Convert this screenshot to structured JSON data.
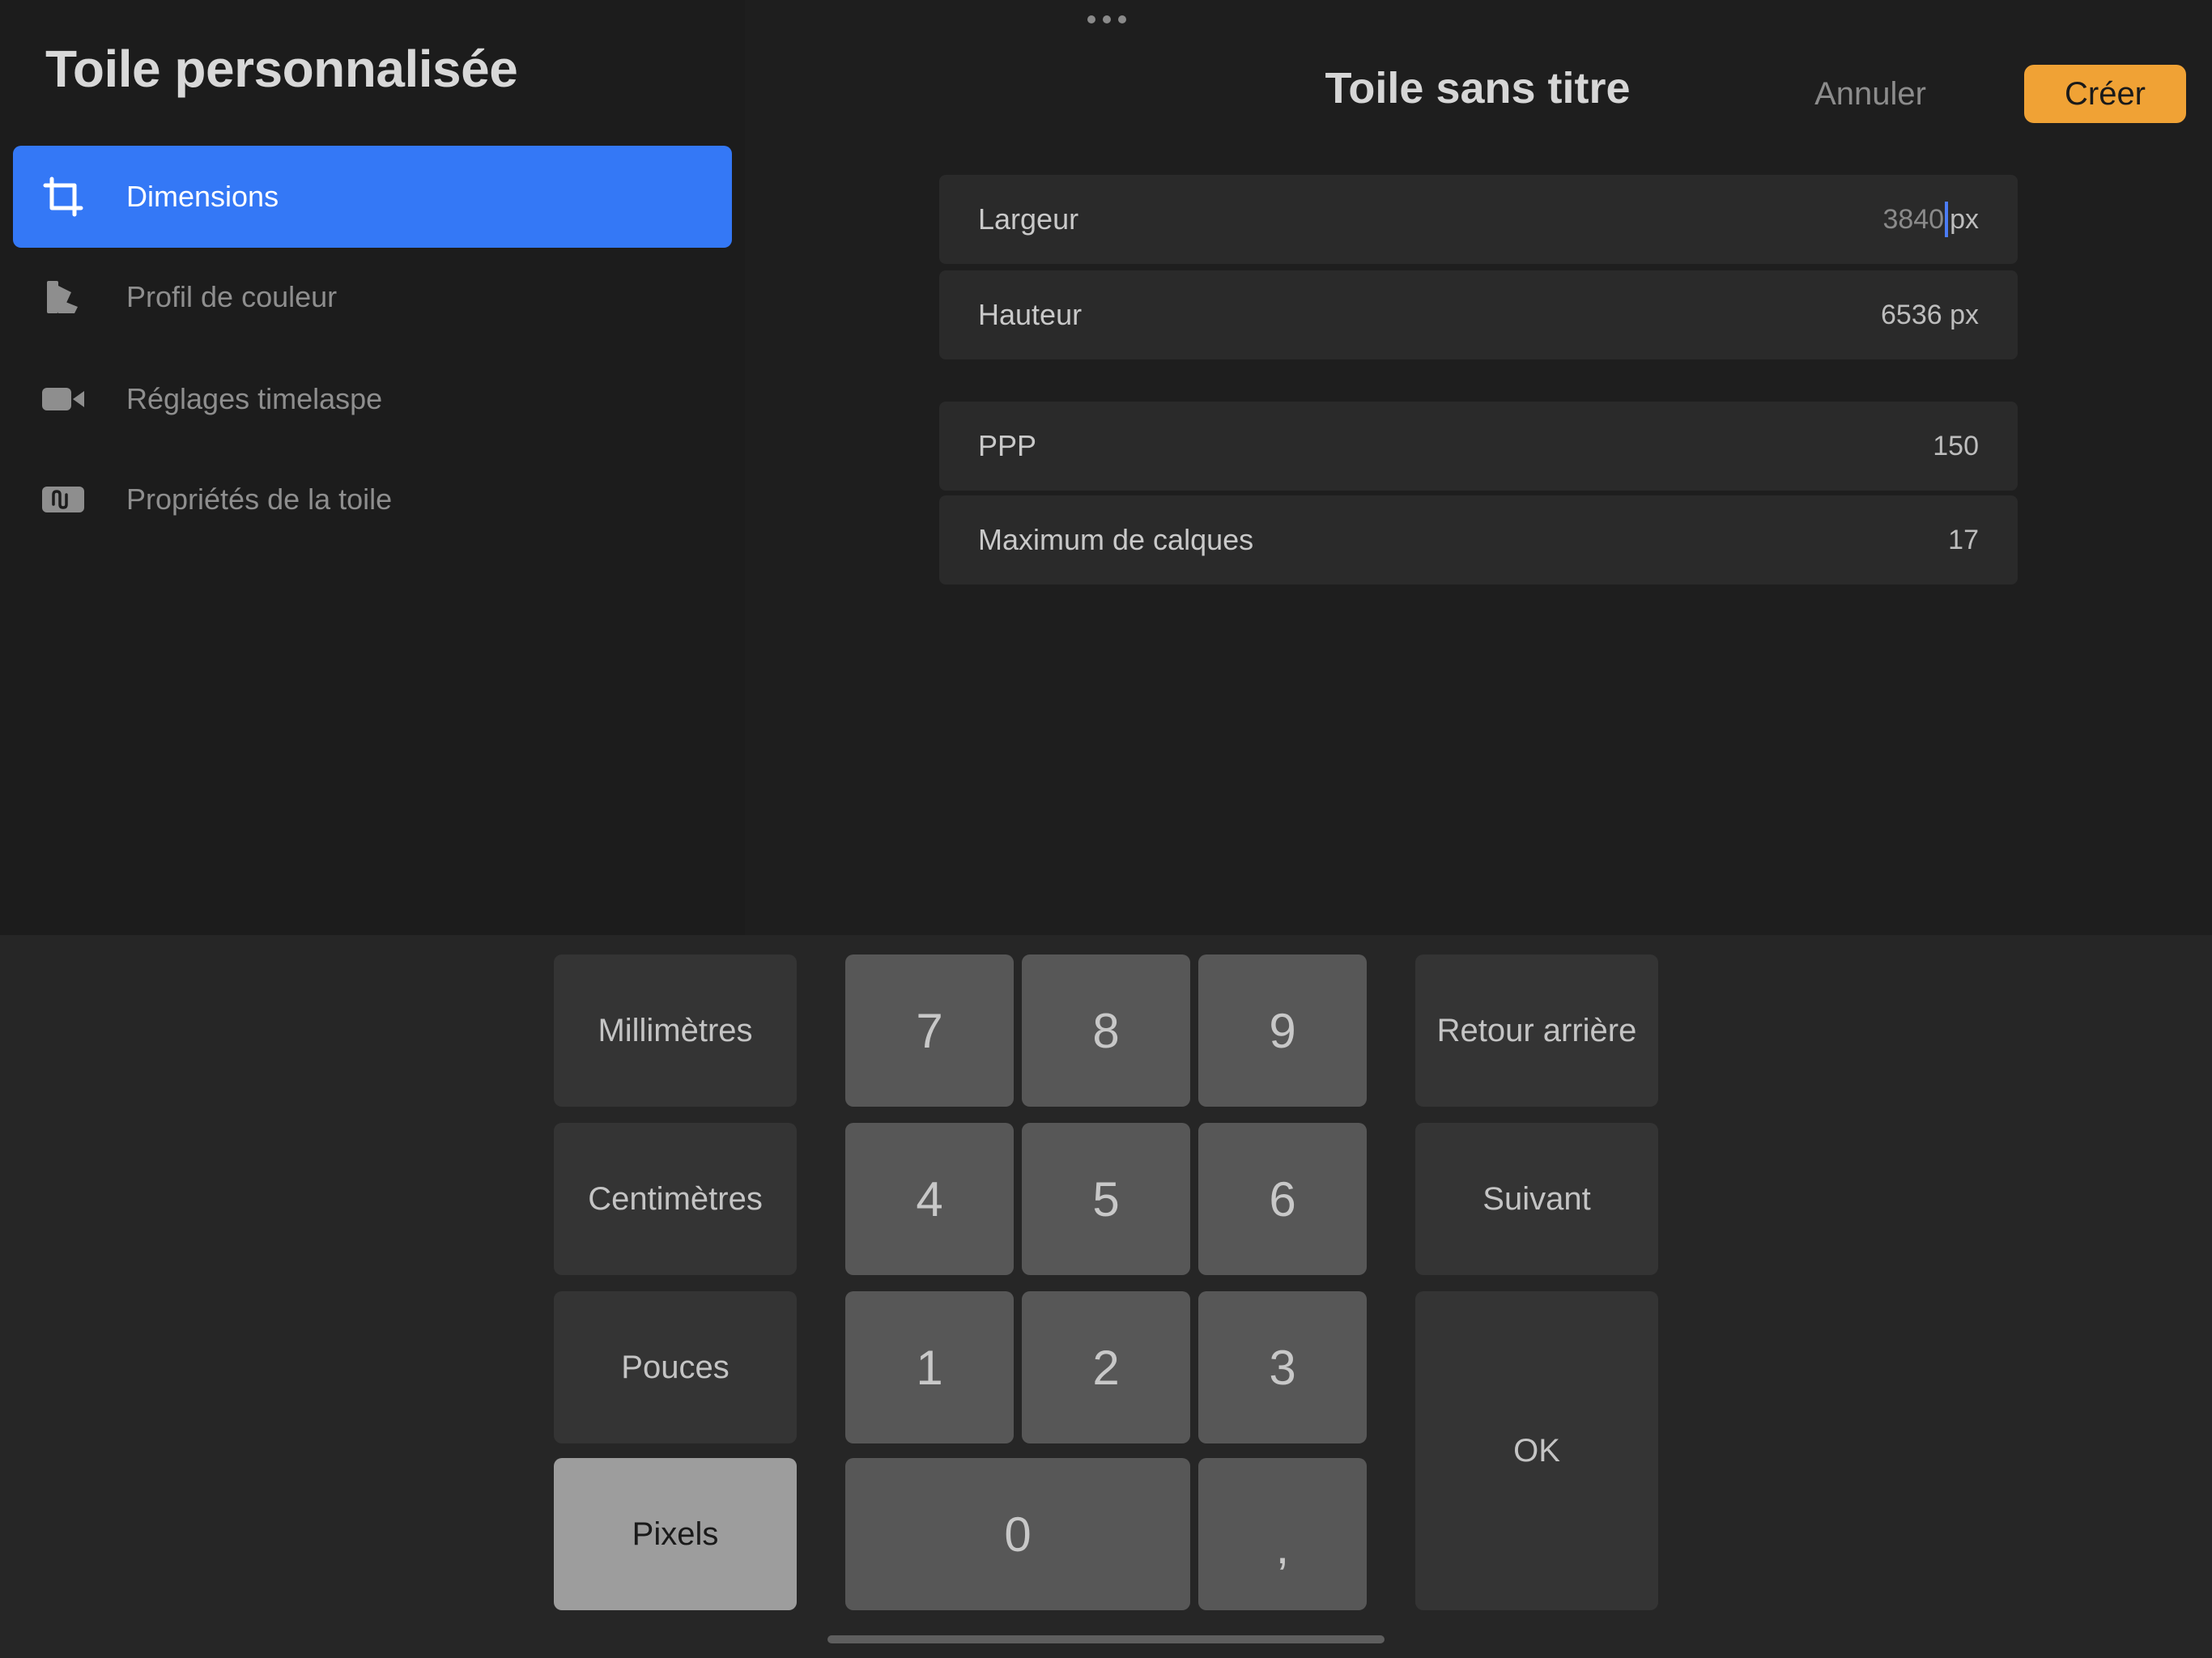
{
  "sidebar": {
    "title": "Toile personnalisée",
    "items": [
      {
        "label": "Dimensions",
        "icon": "crop-icon",
        "active": true
      },
      {
        "label": "Profil de couleur",
        "icon": "color-swatch-icon",
        "active": false
      },
      {
        "label": "Réglages timelaspe",
        "icon": "video-camera-icon",
        "active": false
      },
      {
        "label": "Propriétés de la toile",
        "icon": "canvas-properties-icon",
        "active": false
      }
    ]
  },
  "header": {
    "title": "Toile sans titre",
    "cancel_label": "Annuler",
    "create_label": "Créer"
  },
  "fields": {
    "width": {
      "label": "Largeur",
      "value": "3840",
      "unit": "px"
    },
    "height": {
      "label": "Hauteur",
      "value": "6536 px"
    },
    "dpi": {
      "label": "PPP",
      "value": "150"
    },
    "max_layers": {
      "label": "Maximum de calques",
      "value": "17"
    }
  },
  "keypad": {
    "units": [
      "Millimètres",
      "Centimètres",
      "Pouces",
      "Pixels"
    ],
    "selected_unit": "Pixels",
    "digits": [
      "7",
      "8",
      "9",
      "4",
      "5",
      "6",
      "1",
      "2",
      "3",
      "0",
      ","
    ],
    "actions": {
      "backspace": "Retour arrière",
      "next": "Suivant",
      "ok": "OK"
    }
  },
  "colors": {
    "accent": "#3478f6",
    "create_button": "#f0a235",
    "background": "#1e1e1e"
  }
}
